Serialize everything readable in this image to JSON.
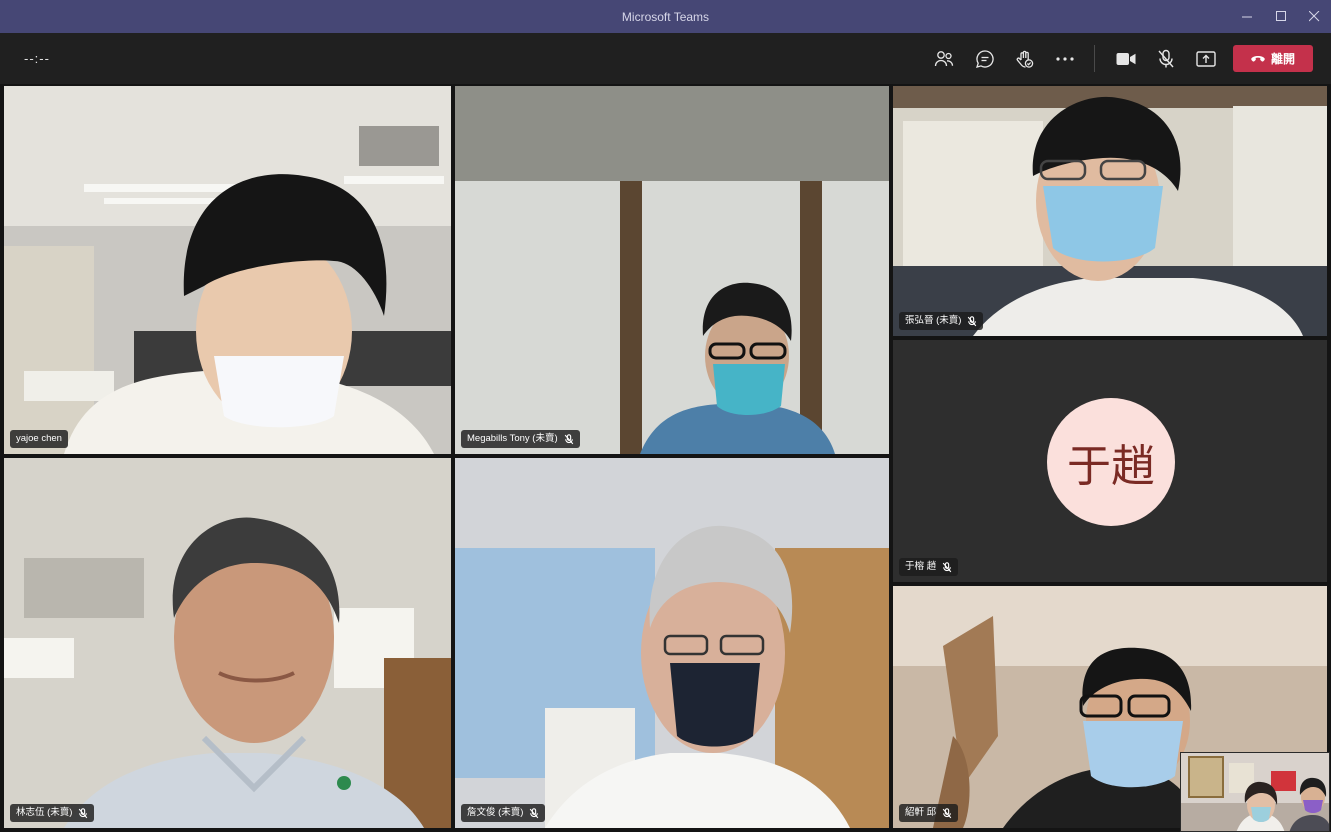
{
  "window": {
    "title": "Microsoft Teams"
  },
  "toolbar": {
    "timer": "--:--",
    "leave_label": "離開",
    "colors": {
      "leave": "#c4314b",
      "toolbar_bg": "#202020",
      "titlebar_bg": "#464775"
    },
    "icons": [
      "participants-icon",
      "chat-icon",
      "raise-hand-icon",
      "more-options-icon",
      "camera-icon",
      "mic-muted-icon",
      "share-screen-icon",
      "phone-hangup-icon"
    ]
  },
  "participants": [
    {
      "name": "yajoe chen",
      "muted": false
    },
    {
      "name": "Megabills Tony (未賣)",
      "muted": true
    },
    {
      "name": "張弘晉 (未賣)",
      "muted": true
    },
    {
      "name": "于榕 趙",
      "muted": true,
      "initials": "于趙",
      "avatar_bg": "#fbe0dc",
      "avatar_fg": "#7a2a24"
    },
    {
      "name": "林志伍 (未賣)",
      "muted": true
    },
    {
      "name": "詹文俊 (未賣)",
      "muted": true
    },
    {
      "name": "紹軒 邱",
      "muted": true
    }
  ]
}
